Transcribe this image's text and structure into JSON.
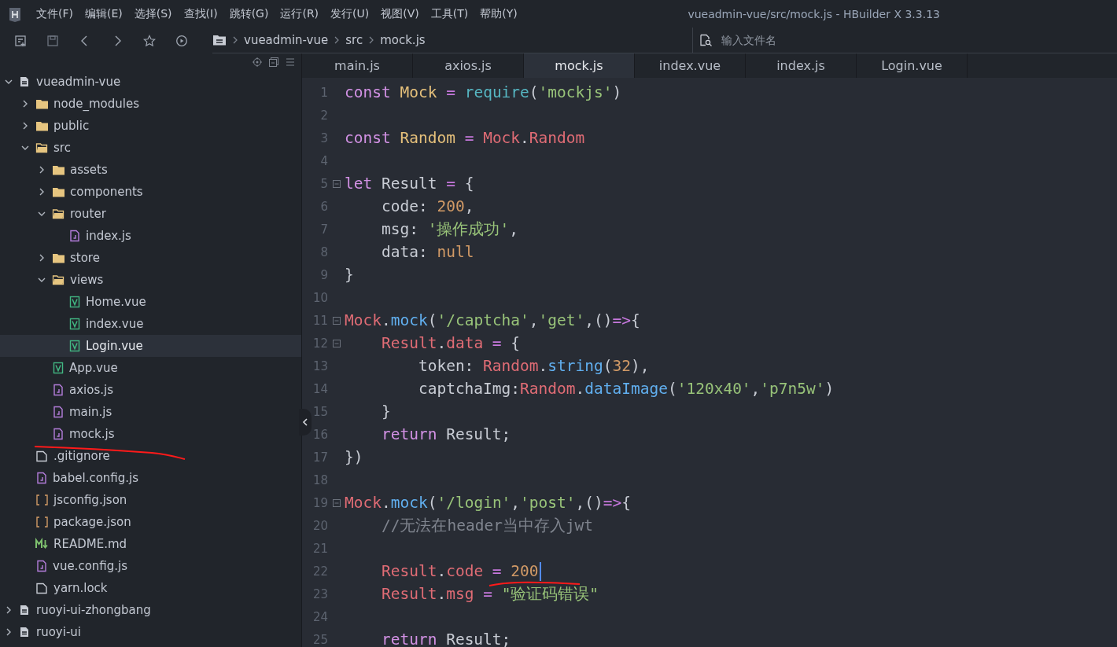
{
  "window": {
    "title": "vueadmin-vue/src/mock.js - HBuilder X 3.3.13"
  },
  "menu": [
    "文件(F)",
    "编辑(E)",
    "选择(S)",
    "查找(I)",
    "跳转(G)",
    "运行(R)",
    "发行(U)",
    "视图(V)",
    "工具(T)",
    "帮助(Y)"
  ],
  "breadcrumb": [
    "vueadmin-vue",
    "src",
    "mock.js"
  ],
  "file_search": {
    "placeholder": "输入文件名"
  },
  "tree": [
    {
      "label": "vueadmin-vue",
      "kind": "project",
      "expanded": true,
      "selected": false,
      "children": [
        {
          "label": "node_modules",
          "kind": "folder",
          "expanded": false,
          "selected": false
        },
        {
          "label": "public",
          "kind": "folder",
          "expanded": false,
          "selected": false
        },
        {
          "label": "src",
          "kind": "folder",
          "expanded": true,
          "selected": false,
          "children": [
            {
              "label": "assets",
              "kind": "folder",
              "expanded": false,
              "selected": false
            },
            {
              "label": "components",
              "kind": "folder",
              "expanded": false,
              "selected": false
            },
            {
              "label": "router",
              "kind": "folder",
              "expanded": true,
              "selected": false,
              "children": [
                {
                  "label": "index.js",
                  "kind": "js",
                  "selected": false
                }
              ]
            },
            {
              "label": "store",
              "kind": "folder",
              "expanded": false,
              "selected": false
            },
            {
              "label": "views",
              "kind": "folder",
              "expanded": true,
              "selected": false,
              "children": [
                {
                  "label": "Home.vue",
                  "kind": "vue",
                  "selected": false
                },
                {
                  "label": "index.vue",
                  "kind": "vue",
                  "selected": false
                },
                {
                  "label": "Login.vue",
                  "kind": "vue",
                  "selected": true
                }
              ]
            },
            {
              "label": "App.vue",
              "kind": "vue",
              "selected": false
            },
            {
              "label": "axios.js",
              "kind": "js",
              "selected": false
            },
            {
              "label": "main.js",
              "kind": "js",
              "selected": false
            },
            {
              "label": "mock.js",
              "kind": "js",
              "selected": false
            }
          ]
        },
        {
          "label": ".gitignore",
          "kind": "file",
          "selected": false
        },
        {
          "label": "babel.config.js",
          "kind": "js",
          "selected": false
        },
        {
          "label": "jsconfig.json",
          "kind": "json",
          "selected": false
        },
        {
          "label": "package.json",
          "kind": "json",
          "selected": false
        },
        {
          "label": "README.md",
          "kind": "md",
          "selected": false
        },
        {
          "label": "vue.config.js",
          "kind": "js",
          "selected": false
        },
        {
          "label": "yarn.lock",
          "kind": "file",
          "selected": false
        }
      ]
    },
    {
      "label": "ruoyi-ui-zhongbang",
      "kind": "project",
      "expanded": false,
      "selected": false
    },
    {
      "label": "ruoyi-ui",
      "kind": "project",
      "expanded": false,
      "selected": false
    }
  ],
  "tabs": [
    {
      "label": "main.js",
      "selected": false
    },
    {
      "label": "axios.js",
      "selected": false
    },
    {
      "label": "mock.js",
      "selected": true
    },
    {
      "label": "index.vue",
      "selected": false
    },
    {
      "label": "index.js",
      "selected": false
    },
    {
      "label": "Login.vue",
      "selected": false
    }
  ],
  "code": [
    {
      "n": "1",
      "tokens": [
        {
          "kind": "kw",
          "text": "const "
        },
        {
          "kind": "var",
          "text": "Mock"
        },
        {
          "kind": "op",
          "text": " = "
        },
        {
          "kind": "fn",
          "text": "require"
        },
        {
          "kind": "plain",
          "text": "("
        },
        {
          "kind": "str",
          "text": "'mockjs'"
        },
        {
          "kind": "plain",
          "text": ")"
        }
      ]
    },
    {
      "n": "2"
    },
    {
      "n": "3",
      "tokens": [
        {
          "kind": "kw",
          "text": "const "
        },
        {
          "kind": "var",
          "text": "Random"
        },
        {
          "kind": "op",
          "text": " = "
        },
        {
          "kind": "obj",
          "text": "Mock"
        },
        {
          "kind": "plain",
          "text": "."
        },
        {
          "kind": "obj",
          "text": "Random"
        }
      ]
    },
    {
      "n": "4"
    },
    {
      "n": "5",
      "fold": true,
      "tokens": [
        {
          "kind": "kw",
          "text": "let "
        },
        {
          "kind": "plain",
          "text": "Result "
        },
        {
          "kind": "op",
          "text": "= "
        },
        {
          "kind": "plain",
          "text": "{"
        }
      ]
    },
    {
      "n": "6",
      "tokens": [
        {
          "kind": "plain",
          "text": "    code: "
        },
        {
          "kind": "num",
          "text": "200"
        },
        {
          "kind": "plain",
          "text": ","
        }
      ]
    },
    {
      "n": "7",
      "tokens": [
        {
          "kind": "plain",
          "text": "    msg: "
        },
        {
          "kind": "str",
          "text": "'操作成功'"
        },
        {
          "kind": "plain",
          "text": ","
        }
      ]
    },
    {
      "n": "8",
      "tokens": [
        {
          "kind": "plain",
          "text": "    data: "
        },
        {
          "kind": "num",
          "text": "null"
        }
      ]
    },
    {
      "n": "9",
      "tokens": [
        {
          "kind": "plain",
          "text": "}"
        }
      ]
    },
    {
      "n": "10"
    },
    {
      "n": "11",
      "fold": true,
      "tokens": [
        {
          "kind": "obj",
          "text": "Mock"
        },
        {
          "kind": "plain",
          "text": "."
        },
        {
          "kind": "method",
          "text": "mock"
        },
        {
          "kind": "plain",
          "text": "("
        },
        {
          "kind": "str",
          "text": "'/captcha'"
        },
        {
          "kind": "plain",
          "text": ","
        },
        {
          "kind": "str",
          "text": "'get'"
        },
        {
          "kind": "plain",
          "text": ",()"
        },
        {
          "kind": "op",
          "text": "=>"
        },
        {
          "kind": "plain",
          "text": "{"
        }
      ]
    },
    {
      "n": "12",
      "fold": true,
      "tokens": [
        {
          "kind": "obj",
          "text": "    Result"
        },
        {
          "kind": "plain",
          "text": "."
        },
        {
          "kind": "obj",
          "text": "data"
        },
        {
          "kind": "op",
          "text": " = "
        },
        {
          "kind": "plain",
          "text": "{"
        }
      ]
    },
    {
      "n": "13",
      "tokens": [
        {
          "kind": "plain",
          "text": "        token: "
        },
        {
          "kind": "obj",
          "text": "Random"
        },
        {
          "kind": "plain",
          "text": "."
        },
        {
          "kind": "method",
          "text": "string"
        },
        {
          "kind": "plain",
          "text": "("
        },
        {
          "kind": "num",
          "text": "32"
        },
        {
          "kind": "plain",
          "text": "),"
        }
      ]
    },
    {
      "n": "14",
      "tokens": [
        {
          "kind": "plain",
          "text": "        captchaImg:"
        },
        {
          "kind": "obj",
          "text": "Random"
        },
        {
          "kind": "plain",
          "text": "."
        },
        {
          "kind": "method",
          "text": "dataImage"
        },
        {
          "kind": "plain",
          "text": "("
        },
        {
          "kind": "str",
          "text": "'120x40'"
        },
        {
          "kind": "plain",
          "text": ","
        },
        {
          "kind": "str",
          "text": "'p7n5w'"
        },
        {
          "kind": "plain",
          "text": ")"
        }
      ]
    },
    {
      "n": "15",
      "tokens": [
        {
          "kind": "plain",
          "text": "    }"
        }
      ]
    },
    {
      "n": "16",
      "tokens": [
        {
          "kind": "kw",
          "text": "    return"
        },
        {
          "kind": "plain",
          "text": " Result;"
        }
      ]
    },
    {
      "n": "17",
      "tokens": [
        {
          "kind": "plain",
          "text": "})"
        }
      ]
    },
    {
      "n": "18"
    },
    {
      "n": "19",
      "fold": true,
      "tokens": [
        {
          "kind": "obj",
          "text": "Mock"
        },
        {
          "kind": "plain",
          "text": "."
        },
        {
          "kind": "method",
          "text": "mock"
        },
        {
          "kind": "plain",
          "text": "("
        },
        {
          "kind": "str",
          "text": "'/login'"
        },
        {
          "kind": "plain",
          "text": ","
        },
        {
          "kind": "str",
          "text": "'post'"
        },
        {
          "kind": "plain",
          "text": ",()"
        },
        {
          "kind": "op",
          "text": "=>"
        },
        {
          "kind": "plain",
          "text": "{"
        }
      ]
    },
    {
      "n": "20",
      "tokens": [
        {
          "kind": "cmt",
          "text": "    //无法在header当中存入jwt"
        }
      ]
    },
    {
      "n": "21"
    },
    {
      "n": "22",
      "cursor": true,
      "tokens": [
        {
          "kind": "obj",
          "text": "    Result"
        },
        {
          "kind": "plain",
          "text": "."
        },
        {
          "kind": "obj",
          "text": "code"
        },
        {
          "kind": "op",
          "text": " = "
        },
        {
          "kind": "num",
          "text": "200"
        }
      ]
    },
    {
      "n": "23",
      "tokens": [
        {
          "kind": "obj",
          "text": "    Result"
        },
        {
          "kind": "plain",
          "text": "."
        },
        {
          "kind": "obj",
          "text": "msg"
        },
        {
          "kind": "op",
          "text": " = "
        },
        {
          "kind": "str",
          "text": "\"验证码错误\""
        }
      ]
    },
    {
      "n": "24"
    },
    {
      "n": "25",
      "tokens": [
        {
          "kind": "kw",
          "text": "    return"
        },
        {
          "kind": "plain",
          "text": " Result;"
        }
      ]
    }
  ]
}
